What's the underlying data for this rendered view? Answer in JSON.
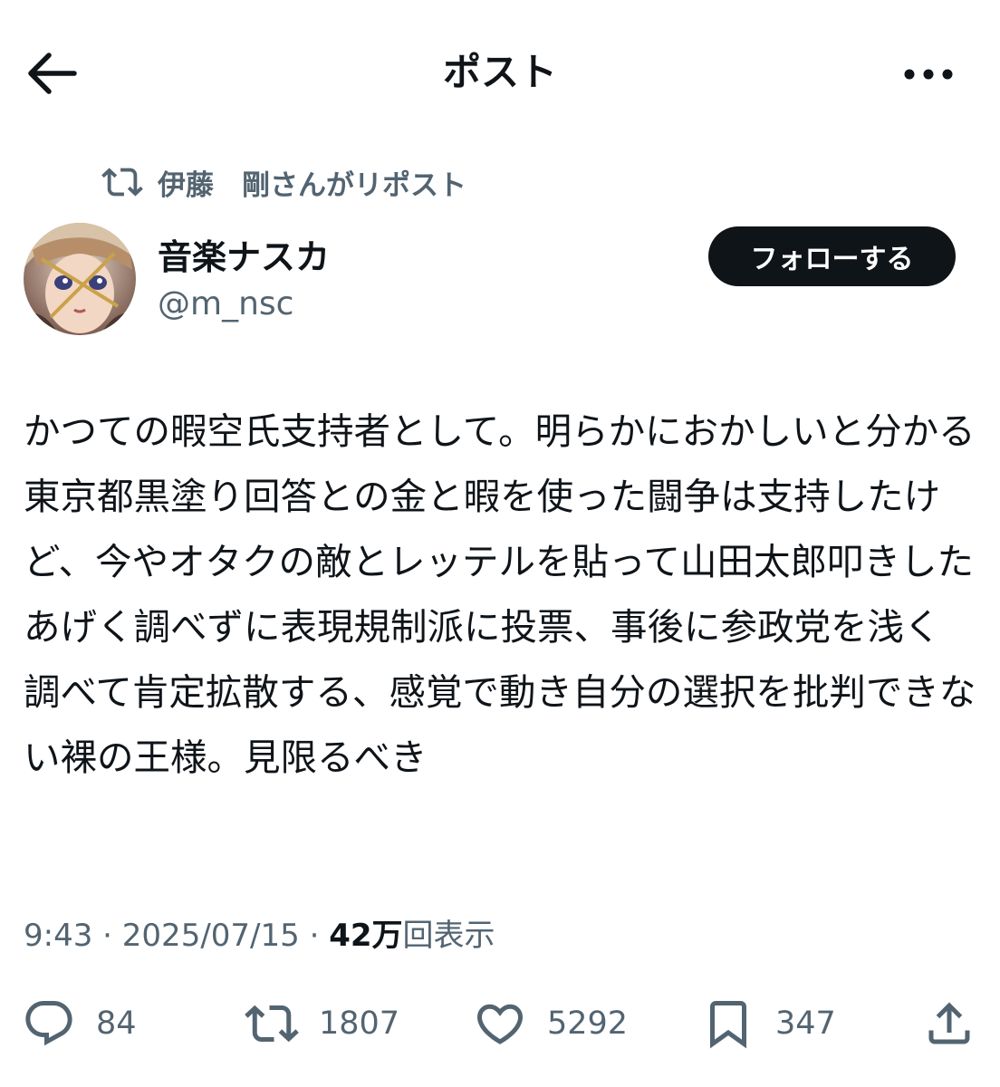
{
  "header": {
    "title": "ポスト",
    "back_icon": "arrow-left-icon",
    "more_icon": "more-horizontal-icon"
  },
  "repost": {
    "icon": "repost-icon",
    "text": "伊藤　剛さんがリポスト"
  },
  "author": {
    "name": "音楽ナスカ",
    "handle": "@m_nsc",
    "follow_label": "フォローする"
  },
  "post": {
    "text": "かつての暇空氏支持者として。明らかにおかしいと分かる東京都黒塗り回答との金と暇を使った闘争は支持したけど、今やオタクの敵とレッテルを貼って山田太郎叩きしたあげく調べずに表現規制派に投票、事後に参政党を浅く調べて肯定拡散する、感覚で動き自分の選択を批判できない裸の王様。見限るべき"
  },
  "meta": {
    "time": "9:43",
    "sep1": " · ",
    "date": "2025/07/15",
    "sep2": " · ",
    "views": "42万",
    "views_suffix": "回表示"
  },
  "actions": {
    "reply_count": "84",
    "retweet_count": "1807",
    "like_count": "5292",
    "bookmark_count": "347"
  },
  "colors": {
    "text": "#0f1419",
    "secondary": "#536471",
    "button": "#0f1419",
    "background": "#ffffff"
  }
}
